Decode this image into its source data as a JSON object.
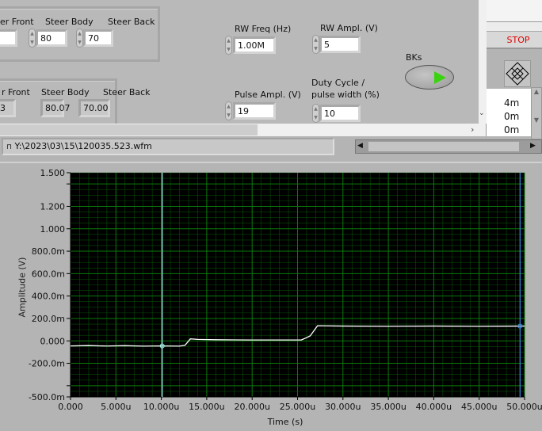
{
  "front_panel": {
    "setpoint_group": {
      "labels": [
        "er Front",
        "Steer Body",
        "Steer Back"
      ],
      "values": [
        "",
        "80",
        "70"
      ]
    },
    "actual_group": {
      "labels": [
        "r Front",
        "Steer Body",
        "Steer Back"
      ],
      "values": [
        "3",
        "80.07",
        "70.00"
      ]
    },
    "rw_freq": {
      "label": "RW Freq (Hz)",
      "value": "1.00M"
    },
    "rw_ampl": {
      "label": "RW Ampl. (V)",
      "value": "5"
    },
    "pulse_ampl": {
      "label": "Pulse Ampl. (V)",
      "value": "19"
    },
    "duty_cycle": {
      "label_line1": "Duty Cycle /",
      "label_line2": "pulse width (%)",
      "value": "10"
    },
    "bks": {
      "label": "BKs",
      "color": "#39d40f"
    }
  },
  "right_panel": {
    "stop_label": "STOP",
    "list_values": [
      "4m",
      "0m",
      "0m"
    ]
  },
  "file_path": "Y:\\2023\\03\\15\\120035.523.wfm",
  "chart_data": {
    "type": "line",
    "xlabel": "Time (s)",
    "ylabel": "Amplitude (V)",
    "xlim": [
      0,
      50
    ],
    "ylim": [
      -0.5,
      1.5
    ],
    "x_unit": "u",
    "x_ticks": [
      "0.000",
      "5.000u",
      "10.000u",
      "15.000u",
      "20.000u",
      "25.000u",
      "30.000u",
      "35.000u",
      "40.000u",
      "45.000u",
      "50.000u"
    ],
    "y_ticks": [
      {
        "v": 1.5,
        "label": "1.500"
      },
      {
        "v": 1.4,
        "label": ""
      },
      {
        "v": 1.2,
        "label": "1.200"
      },
      {
        "v": 1.0,
        "label": "1.000"
      },
      {
        "v": 0.8,
        "label": "800.0m"
      },
      {
        "v": 0.6,
        "label": "600.0m"
      },
      {
        "v": 0.4,
        "label": "400.0m"
      },
      {
        "v": 0.2,
        "label": "200.0m"
      },
      {
        "v": 0.0,
        "label": "0.000"
      },
      {
        "v": -0.2,
        "label": "-200.0m"
      },
      {
        "v": -0.4,
        "label": ""
      },
      {
        "v": -0.5,
        "label": "-500.0m"
      }
    ],
    "grid": true,
    "background": "#000000",
    "grid_color": "#0a7a0a",
    "trace_color": "#ffffff",
    "series": [
      {
        "x": [
          0,
          2,
          4,
          6,
          8,
          10,
          12,
          12.6,
          13.2,
          14,
          16,
          18,
          20,
          22,
          24,
          25.4,
          25.9,
          26.4,
          26.8,
          27.2,
          30,
          35,
          40,
          45,
          50
        ],
        "y": [
          -0.045,
          -0.042,
          -0.046,
          -0.043,
          -0.047,
          -0.045,
          -0.047,
          -0.04,
          0.018,
          0.013,
          0.01,
          0.009,
          0.008,
          0.008,
          0.008,
          0.008,
          0.025,
          0.045,
          0.09,
          0.135,
          0.132,
          0.13,
          0.132,
          0.13,
          0.132
        ]
      }
    ],
    "cursors": [
      {
        "x": 10.1,
        "color": "#9ff5ea"
      },
      {
        "x": 49.5,
        "color": "#3a8fe8"
      }
    ]
  }
}
